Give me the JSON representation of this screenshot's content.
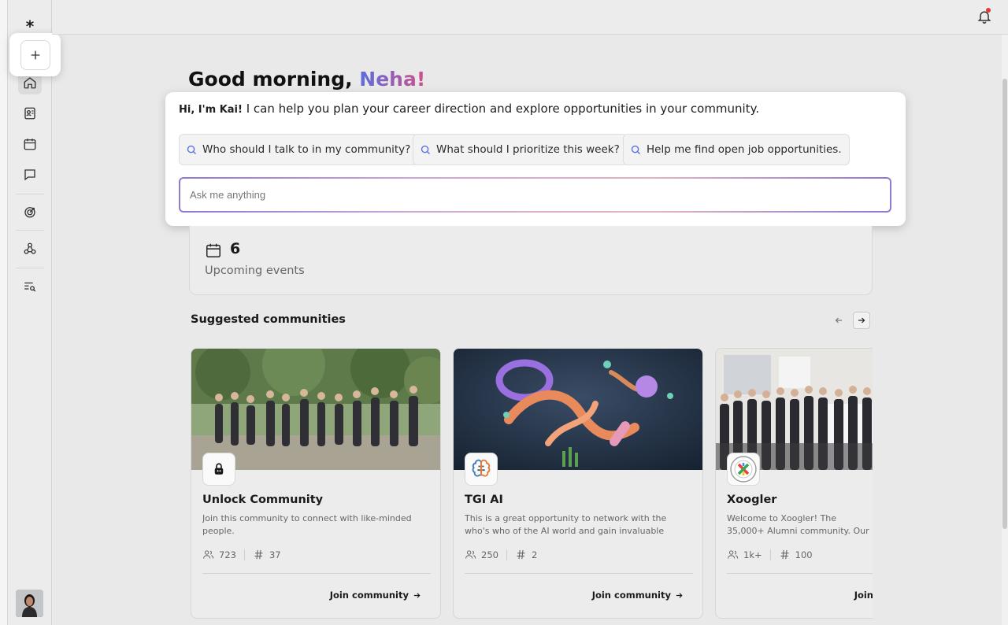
{
  "app": {
    "logo_text": "⁎"
  },
  "greeting": {
    "prefix": "Good morning, ",
    "name": "Neha!"
  },
  "kai": {
    "intro_bold": "Hi, I'm Kai!",
    "intro_rest": " I can help you plan your career direction and explore opportunities in your community.",
    "suggestions": [
      "Who should I talk to in my community?",
      "What should I prioritize this week?",
      "Help me find open job opportunities."
    ],
    "input_placeholder": "Ask me anything"
  },
  "events": {
    "count": "6",
    "label": "Upcoming events"
  },
  "communities": {
    "title": "Suggested communities",
    "items": [
      {
        "name": "Unlock Community",
        "description": "Join this community to connect with like-minded people.",
        "members": "723",
        "channels": "37",
        "join_label": "Join community"
      },
      {
        "name": "TGI AI",
        "description": "This is a great opportunity to network with the who's who of the AI world and gain invaluable insights. \"TGI...",
        "members": "250",
        "channels": "2",
        "join_label": "Join community"
      },
      {
        "name": "Xoogler",
        "description": "Welcome to Xoogler! The 35,000+ Alumni community. Our community",
        "members": "1k+",
        "channels": "100",
        "join_label": "Join community"
      }
    ]
  },
  "colors": {
    "accent_start": "#5a6ee0",
    "accent_end": "#d24f8a",
    "notification": "#e53935"
  }
}
